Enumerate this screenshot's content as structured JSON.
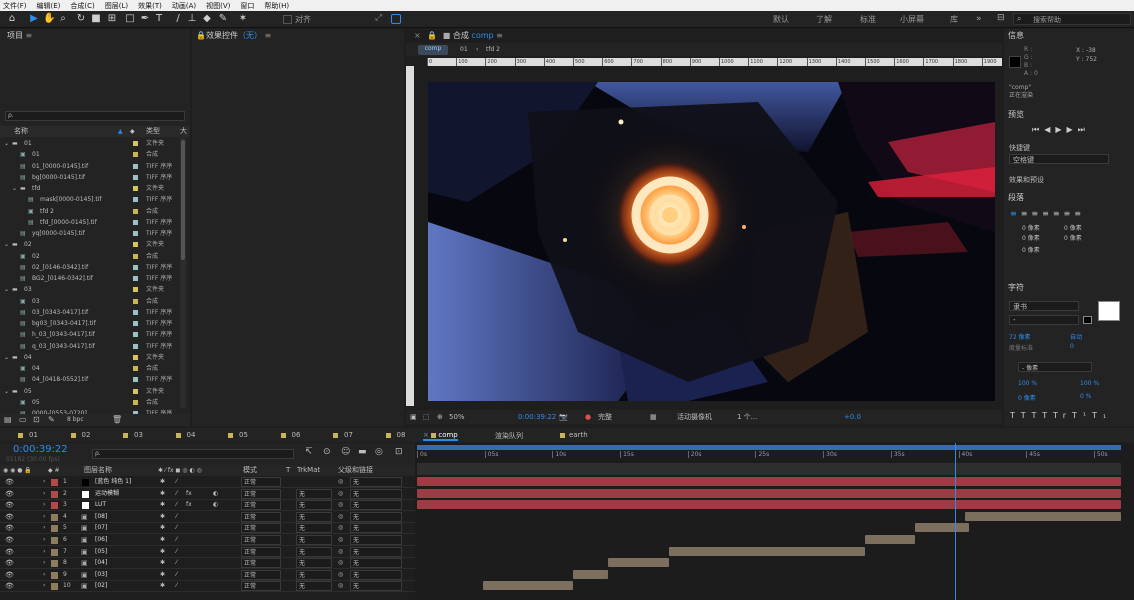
{
  "menu": [
    "文件(F)",
    "编辑(E)",
    "合成(C)",
    "图层(L)",
    "效果(T)",
    "动画(A)",
    "视图(V)",
    "窗口",
    "帮助(H)"
  ],
  "toolbar": {
    "align_label": "对齐",
    "workspaces": [
      "默认",
      "了解",
      "标准",
      "小屏幕",
      "库"
    ],
    "search_placeholder": "搜索帮助"
  },
  "project": {
    "title": "项目",
    "search_prefix": "ρ.",
    "col_name": "名称",
    "col_type": "类型",
    "col_size": "大",
    "items": [
      {
        "name": "01",
        "type": "文件夹",
        "c": "#d9c45a",
        "icon": "folder",
        "indent": 0,
        "twirl": true
      },
      {
        "name": "01",
        "type": "合成",
        "c": "#c9b45a",
        "icon": "comp",
        "indent": 1
      },
      {
        "name": "01_[0000-0145].tif",
        "type": "TIFF 序序",
        "c": "#9bc1c6",
        "icon": "file",
        "indent": 1
      },
      {
        "name": "bg[0000-0145].tif",
        "type": "TIFF 序序",
        "c": "#9bc1c6",
        "icon": "file",
        "indent": 1
      },
      {
        "name": "tfd",
        "type": "文件夹",
        "c": "#d9c45a",
        "icon": "folder",
        "indent": 1,
        "twirl": true
      },
      {
        "name": "mask[0000-0145].tif",
        "type": "TIFF 序序",
        "c": "#9bc1c6",
        "icon": "file",
        "indent": 2
      },
      {
        "name": "tfd 2",
        "type": "合成",
        "c": "#c9b45a",
        "icon": "comp",
        "indent": 2
      },
      {
        "name": "tfd_[0000-0145].tif",
        "type": "TIFF 序序",
        "c": "#9bc1c6",
        "icon": "file",
        "indent": 2
      },
      {
        "name": "yq[0000-0145].tif",
        "type": "TIFF 序序",
        "c": "#9bc1c6",
        "icon": "file",
        "indent": 1
      },
      {
        "name": "02",
        "type": "文件夹",
        "c": "#d9c45a",
        "icon": "folder",
        "indent": 0,
        "twirl": true
      },
      {
        "name": "02",
        "type": "合成",
        "c": "#c9b45a",
        "icon": "comp",
        "indent": 1
      },
      {
        "name": "02_[0146-0342].tif",
        "type": "TIFF 序序",
        "c": "#9bc1c6",
        "icon": "file",
        "indent": 1
      },
      {
        "name": "BG2_[0146-0342].tif",
        "type": "TIFF 序序",
        "c": "#9bc1c6",
        "icon": "file",
        "indent": 1
      },
      {
        "name": "03",
        "type": "文件夹",
        "c": "#d9c45a",
        "icon": "folder",
        "indent": 0,
        "twirl": true
      },
      {
        "name": "03",
        "type": "合成",
        "c": "#c9b45a",
        "icon": "comp",
        "indent": 1
      },
      {
        "name": "03_[0343-0417].tif",
        "type": "TIFF 序序",
        "c": "#9bc1c6",
        "icon": "file",
        "indent": 1
      },
      {
        "name": "bg03_[0343-0417].tif",
        "type": "TIFF 序序",
        "c": "#9bc1c6",
        "icon": "file",
        "indent": 1
      },
      {
        "name": "h_03_[0343-0417].tif",
        "type": "TIFF 序序",
        "c": "#9bc1c6",
        "icon": "file",
        "indent": 1
      },
      {
        "name": "q_03_[0343-0417].tif",
        "type": "TIFF 序序",
        "c": "#9bc1c6",
        "icon": "file",
        "indent": 1
      },
      {
        "name": "04",
        "type": "文件夹",
        "c": "#d9c45a",
        "icon": "folder",
        "indent": 0,
        "twirl": true
      },
      {
        "name": "04",
        "type": "合成",
        "c": "#c9b45a",
        "icon": "comp",
        "indent": 1
      },
      {
        "name": "04_[0418-0552].tif",
        "type": "TIFF 序序",
        "c": "#9bc1c6",
        "icon": "file",
        "indent": 1
      },
      {
        "name": "05",
        "type": "文件夹",
        "c": "#d9c45a",
        "icon": "folder",
        "indent": 0,
        "twirl": true
      },
      {
        "name": "05",
        "type": "合成",
        "c": "#c9b45a",
        "icon": "comp",
        "indent": 1
      },
      {
        "name": "0000-[0553-0720]",
        "type": "TIFF 序序",
        "c": "#9bc1c6",
        "icon": "file",
        "indent": 1
      }
    ],
    "bpc": "8 bpc"
  },
  "effects": {
    "title": "效果控件",
    "value": "（无）"
  },
  "comp": {
    "title": "合成",
    "name": "comp",
    "tabs": [
      "comp",
      "01",
      "tfd 2"
    ],
    "ruler": [
      "0",
      "100",
      "200",
      "300",
      "400",
      "500",
      "600",
      "700",
      "800",
      "900",
      "1000",
      "1100",
      "1200",
      "1300",
      "1400",
      "1500",
      "1600",
      "1700",
      "1800",
      "1900"
    ],
    "zoom": "50%",
    "timecode": "0:00:39:22",
    "quality": "完整",
    "camera": "活动摄像机",
    "views": "1 个...",
    "exposure": "+0.0"
  },
  "info": {
    "title": "信息",
    "r": "R :",
    "g": "G :",
    "b": "B :",
    "a": "A : 0",
    "x": "X : -38",
    "y": "Y : 752",
    "comp": "\"comp\"",
    "status": "正在渲染"
  },
  "preview": {
    "title": "预览",
    "shortcut_label": "快捷键",
    "shortcut": "空格键"
  },
  "presets": {
    "title": "效果和预设"
  },
  "paragraph": {
    "title": "段落",
    "v1": "0 像素",
    "v2": "0 像素",
    "v3": "0 像素",
    "v4": "0 像素",
    "v5": "0 像素"
  },
  "character": {
    "title": "字符",
    "font": "隶书",
    "style": "-",
    "size": "72 像素",
    "leading": "自动",
    "kerning": "度量标准",
    "tracking": "0",
    "unit": "- 像素",
    "scale_v": "100 %",
    "scale_h": "100 %",
    "baseline": "0 像素",
    "tsume": "0 %",
    "styles": [
      "T",
      "T",
      "TT",
      "Tr",
      "T¹",
      "T₁"
    ]
  },
  "timeline": {
    "comp_tabs": [
      "01",
      "02",
      "03",
      "04",
      "05",
      "06",
      "07",
      "08"
    ],
    "active_tab": "comp",
    "render_tab": "渲染队列",
    "earth_tab": "earth",
    "timecode": "0:00:39:22",
    "frames": "01182 (30.00 fps)",
    "col_name": "图层名称",
    "col_mode": "模式",
    "col_t": "T",
    "col_trkmat": "TrkMat",
    "col_parent": "父级和链接",
    "ruler": [
      "0s",
      "05s",
      "10s",
      "15s",
      "20s",
      "25s",
      "30s",
      "35s",
      "40s",
      "45s",
      "50s"
    ],
    "layers": [
      {
        "num": "1",
        "name": "[蓝色 纯色 1]",
        "color": "#b34a4a",
        "swatch": "#000",
        "mode": "正常",
        "trk": "",
        "parent": "无",
        "start": 0,
        "end": 52,
        "barc": "#9c3d45",
        "fx": false
      },
      {
        "num": "2",
        "name": "运动模糊",
        "color": "#b34a4a",
        "swatch": "#fff",
        "mode": "正常",
        "trk": "无",
        "parent": "无",
        "start": 0,
        "end": 52,
        "barc": "#9c3d45",
        "fx": true
      },
      {
        "num": "3",
        "name": "LUT",
        "color": "#b34a4a",
        "swatch": "#fff",
        "mode": "正常",
        "trk": "无",
        "parent": "无",
        "start": 0,
        "end": 52,
        "barc": "#9c3d45",
        "fx": true
      },
      {
        "num": "4",
        "name": "[08]",
        "color": "#8e7c5e",
        "swatch": "",
        "mode": "正常",
        "trk": "无",
        "parent": "无",
        "start": 40.5,
        "end": 52,
        "barc": "#7d6f5e",
        "fx": false
      },
      {
        "num": "5",
        "name": "[07]",
        "color": "#8e7c5e",
        "swatch": "",
        "mode": "正常",
        "trk": "无",
        "parent": "无",
        "start": 36.8,
        "end": 40.8,
        "barc": "#7d6f5e",
        "fx": false
      },
      {
        "num": "6",
        "name": "[06]",
        "color": "#8e7c5e",
        "swatch": "",
        "mode": "正常",
        "trk": "无",
        "parent": "无",
        "start": 33.1,
        "end": 36.8,
        "barc": "#7d6f5e",
        "fx": false
      },
      {
        "num": "7",
        "name": "[05]",
        "color": "#8e7c5e",
        "swatch": "",
        "mode": "正常",
        "trk": "无",
        "parent": "无",
        "start": 18.6,
        "end": 33.1,
        "barc": "#7d6f5e",
        "fx": false
      },
      {
        "num": "8",
        "name": "[04]",
        "color": "#8e7c5e",
        "swatch": "",
        "mode": "正常",
        "trk": "无",
        "parent": "无",
        "start": 14.1,
        "end": 18.6,
        "barc": "#7d6f5e",
        "fx": false
      },
      {
        "num": "9",
        "name": "[03]",
        "color": "#8e7c5e",
        "swatch": "",
        "mode": "正常",
        "trk": "无",
        "parent": "无",
        "start": 11.5,
        "end": 14.1,
        "barc": "#7d6f5e",
        "fx": false
      },
      {
        "num": "10",
        "name": "[02]",
        "color": "#8e7c5e",
        "swatch": "",
        "mode": "正常",
        "trk": "无",
        "parent": "无",
        "start": 4.9,
        "end": 11.5,
        "barc": "#7d6f5e",
        "fx": false
      }
    ],
    "playhead_seconds": 39.73,
    "duration_seconds": 52
  },
  "colors": {
    "accent": "#2d8ceb",
    "bg": "#232323",
    "dark": "#1b1b1b"
  }
}
